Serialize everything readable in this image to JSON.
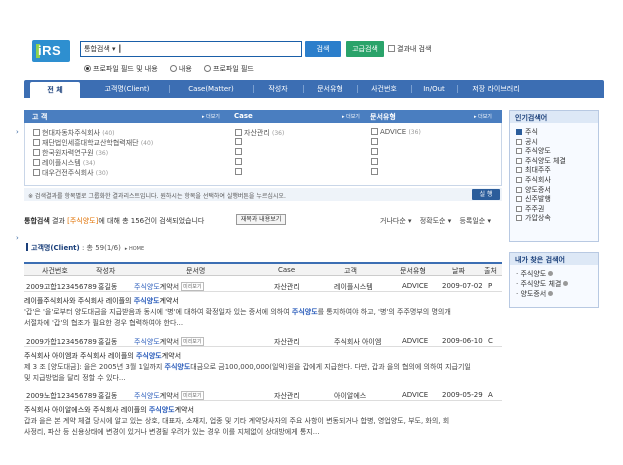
{
  "logo": {
    "text": "iRS"
  },
  "search": {
    "value": "통합검색 ▾ ┃",
    "search_label": "검색",
    "advanced_label": "고급검색",
    "within_label": "결과내 검색",
    "scope_options": [
      "프로파일 필드 및 내용",
      "내용",
      "프로파일 필드"
    ]
  },
  "nav": {
    "tabs": [
      "전 체",
      "고객명(Client)",
      "Case(Matter)",
      "작성자",
      "문서유형",
      "사건번호",
      "In/Out",
      "저장 라이브러리"
    ]
  },
  "facets": {
    "client": {
      "title": "고 객",
      "more": "▸ 더보기",
      "items": [
        {
          "name": "현대자동차주식회사",
          "count": "(40)"
        },
        {
          "name": "재단법인세흥대학교산학협력재단",
          "count": "(40)"
        },
        {
          "name": "한국원자력연구원",
          "count": "(36)"
        },
        {
          "name": "레이플시스템",
          "count": "(34)"
        },
        {
          "name": "대우건전주식회사",
          "count": "(30)"
        }
      ]
    },
    "case": {
      "title": "Case",
      "more": "▸ 더보기",
      "items": [
        {
          "name": "자산관리",
          "count": "(36)"
        }
      ]
    },
    "doctype": {
      "title": "문서유형",
      "more": "▸ 더보기",
      "items": [
        {
          "name": "ADVICE",
          "count": "(36)"
        }
      ]
    },
    "note": "※ 검색결과를 항목별로 그룹화한 결과리스트입니다. 원하시는 항목을 선택하여 실행버튼을 누르십시오.",
    "run_label": "실 행"
  },
  "summary": {
    "prefix": "통합검색",
    "mid1": " 결과 ",
    "keyword": "[주식양도]",
    "mid2": "에 대해 총 156건이 검색되었습니다",
    "reuse_label": "재목과 내용보기",
    "sort1": "거나다순 ▾",
    "sort2": "정확도순 ▾",
    "sort3": "등록일순 ▾"
  },
  "section": {
    "title": "고객명(Client)",
    "count": " : 총 59(1/6)",
    "home": "▸ HOME"
  },
  "table": {
    "headers": [
      "사건번호",
      "작성자",
      "문서명",
      "Case",
      "고객",
      "문서유형",
      "날짜",
      "출처"
    ],
    "rows": [
      {
        "case_no": "2009고합123456789",
        "author": "홍길동",
        "doc_kw": "주식양도",
        "doc_rest": "계약서",
        "mini": "미리보기",
        "case": "자산관리",
        "client": "레이플시스템",
        "type": "ADVICE",
        "date": "2009-07-02",
        "src": "P",
        "snip_title": "레이플주식회사와 주식회사 레이플의 ",
        "snip_kw": "주식양도",
        "snip_title_rest": "계약서",
        "snip1": "'갑'은 '을'로부터 양도대금을 지급받음과 동시에 '병'에 대하여 확정일자 있는 증서에 의하여 ",
        "snip1_kw": "주식양도",
        "snip1_rest": "를 통지하여야 하고, '병'의 주주명부의 명의개",
        "snip2": "서절차에 '갑'의 협조가 필요한 경우 협력하여야 한다..."
      },
      {
        "case_no": "2009가합123456789",
        "author": "홍길동",
        "doc_kw": "주식양도",
        "doc_rest": "계약서",
        "mini": "미리보기",
        "case": "자산관리",
        "client": "주식회사 아이엠",
        "type": "ADVICE",
        "date": "2009-06-10",
        "src": "C",
        "snip_title": "주식회사 아이엠과 주식회사 레이플의 ",
        "snip_kw": "주식양도",
        "snip_title_rest": "계약서",
        "snip1": "제 3 조 [양도대금]: 을은 2005년 3월 1일까지 ",
        "snip1_kw": "주식양도",
        "snip1_rest": "대금으로 금100,000,000(일억)원을 갑에게 지급한다. 다만, 갑과 을의 협의에 의하여 지급기일",
        "snip2": "및 지급방법을 달리 정할 수 있다..."
      },
      {
        "case_no": "2009노합123456789",
        "author": "홍길동",
        "doc_kw": "주식양도",
        "doc_rest": "계약서",
        "mini": "미리보기",
        "case": "자산관리",
        "client": "아이알에스",
        "type": "ADVICE",
        "date": "2009-05-29",
        "src": "A",
        "snip_title": "주식회사 아이알에스와 주식회사 레이플의 ",
        "snip_kw": "주식양도",
        "snip_title_rest": "계약서",
        "snip1": "갑과 을은 본 계약 체결 당시에 알고 있는 상호, 대표자, 소재지, 업종 및  기타 계약당사자의 주요 사항이 변동되거나 합병, 영업양도, 부도, 화의, 회",
        "snip1_kw": "",
        "snip1_rest": "",
        "snip2": "사정리, 파산 등 신용상태에 변경이 있거나 변경될 우려가 있는 경우 이를 지체없이 상대방에게 통지..."
      }
    ]
  },
  "popular": {
    "title": "인기검색어",
    "items": [
      "주식",
      "공시",
      "주식양도",
      "주식양도 체결",
      "최대주주",
      "주식회사",
      "양도증서",
      "신주발행",
      "주주권",
      "가압상속"
    ]
  },
  "mine": {
    "title": "내가 찾은 검색어",
    "items": [
      "주식양도",
      "주식양도 체결",
      "양도증서"
    ]
  }
}
